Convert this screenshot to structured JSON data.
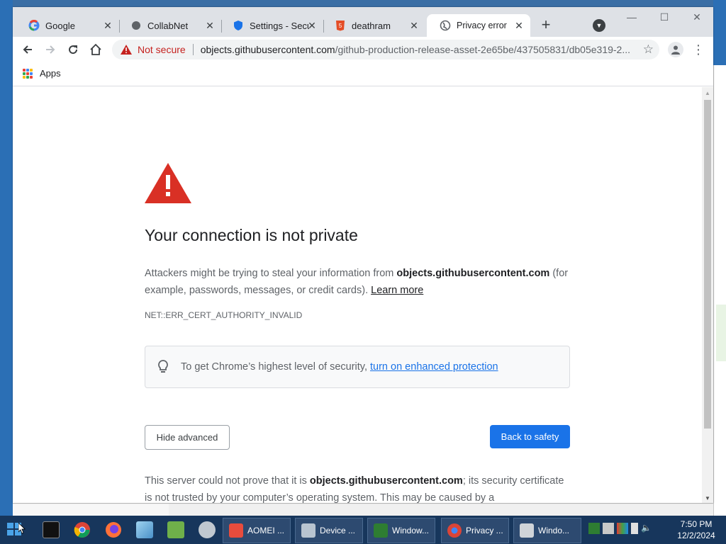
{
  "browser": {
    "tabs": [
      {
        "title": "Google",
        "favicon": "google-icon",
        "active": false
      },
      {
        "title": "CollabNet",
        "favicon": "collabnet-icon",
        "active": false
      },
      {
        "title": "Settings - Secu",
        "favicon": "settings-icon",
        "active": false
      },
      {
        "title": "deathram",
        "favicon": "html5-icon",
        "active": false
      },
      {
        "title": "Privacy error",
        "favicon": "globe-icon",
        "active": true
      }
    ],
    "window_controls": {
      "minimize": "—",
      "maximize": "☐",
      "close": "✕"
    },
    "omnibox": {
      "security_label": "Not secure",
      "url_host": "objects.githubusercontent.com",
      "url_path": "/github-production-release-asset-2e65be/437505831/db05e319-2..."
    },
    "bookmarks": {
      "apps_label": "Apps"
    }
  },
  "page": {
    "headline": "Your connection is not private",
    "description_prefix": "Attackers might be trying to steal your information from ",
    "description_host": "objects.githubusercontent.com",
    "description_suffix": " (for example, passwords, messages, or credit cards). ",
    "learn_more": "Learn more",
    "error_code": "NET::ERR_CERT_AUTHORITY_INVALID",
    "tip_prefix": "To get Chrome’s highest level of security,",
    "tip_link": "turn on enhanced protection",
    "hide_advanced": "Hide advanced",
    "back_to_safety": "Back to safety",
    "detail_prefix": "This server could not prove that it is ",
    "detail_host": "objects.githubusercontent.com",
    "detail_suffix": "; its security certificate is not trusted by your computer’s operating system. This may be caused by a"
  },
  "taskbar": {
    "tasks": [
      {
        "label": "AOMEI ...",
        "icon": "aomei-icon"
      },
      {
        "label": "Device ...",
        "icon": "device-manager-icon"
      },
      {
        "label": "Window...",
        "icon": "windows-icon"
      },
      {
        "label": "Privacy ...",
        "icon": "chrome-icon"
      },
      {
        "label": "Windo...",
        "icon": "drive-icon"
      }
    ],
    "clock_time": "7:50 PM",
    "clock_date": "12/2/2024"
  },
  "colors": {
    "accent": "#1a73e8",
    "warning_red": "#d93025",
    "taskbar": "#17365c"
  }
}
